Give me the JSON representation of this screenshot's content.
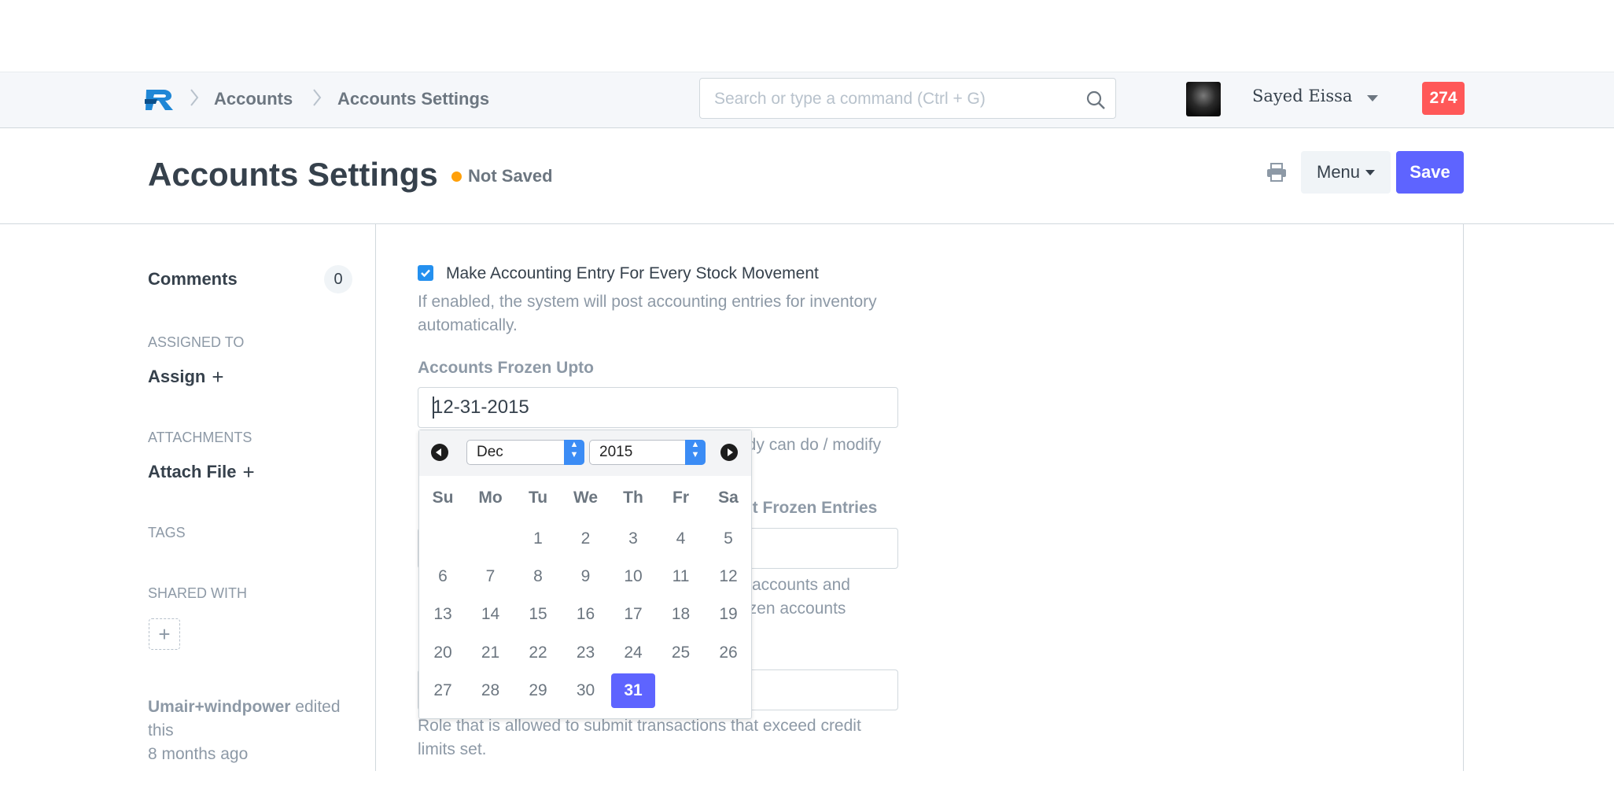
{
  "navbar": {
    "breadcrumbs": [
      "Accounts",
      "Accounts Settings"
    ],
    "search_placeholder": "Search or type a command (Ctrl + G)",
    "username": "Sayed Eissa",
    "notification_count": "274"
  },
  "page": {
    "title": "Accounts Settings",
    "status": "Not Saved",
    "status_color": "#ffa00a",
    "menu_label": "Menu",
    "save_label": "Save",
    "accent": "#5e64ff"
  },
  "sidebar": {
    "comments_label": "Comments",
    "comments_count": "0",
    "assigned_to_label": "ASSIGNED TO",
    "assign_label": "Assign",
    "attachments_label": "ATTACHMENTS",
    "attach_label": "Attach File",
    "tags_label": "TAGS",
    "shared_with_label": "SHARED WITH",
    "activity_user": "Umair+windpower",
    "activity_action": "edited this",
    "activity_time": "8 months ago"
  },
  "form": {
    "stock_checkbox_label": "Make Accounting Entry For Every Stock Movement",
    "stock_checkbox_checked": true,
    "stock_help": "If enabled, the system will post accounting entries for inventory automatically.",
    "frozen_label": "Accounts Frozen Upto",
    "frozen_value": "12-31-2015",
    "frozen_help_partial": "ody can do / modify",
    "role_label_partial": "dit Frozen Entries",
    "role_help_partial_1": "accounts and",
    "role_help_partial_2": "ozen accounts",
    "credit_help": "Role that is allowed to submit transactions that exceed credit limits set."
  },
  "datepicker": {
    "month": "Dec",
    "year": "2015",
    "weekdays": [
      "Su",
      "Mo",
      "Tu",
      "We",
      "Th",
      "Fr",
      "Sa"
    ],
    "first_weekday_index": 2,
    "days_in_month": 31,
    "selected_day": 31
  }
}
